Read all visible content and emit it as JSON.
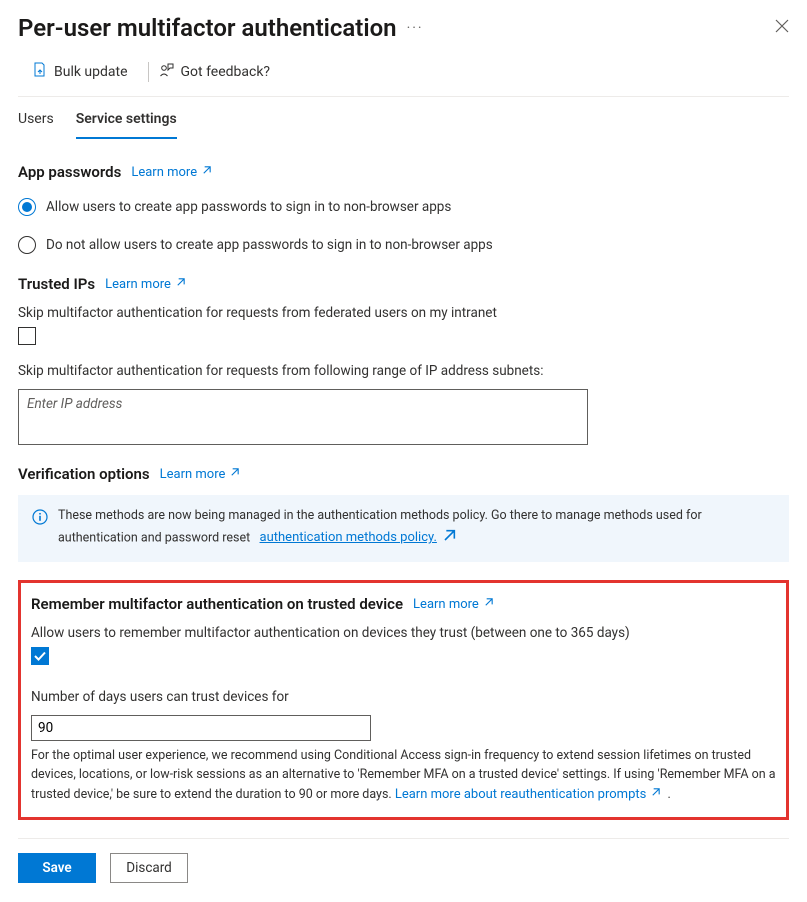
{
  "header": {
    "title": "Per-user multifactor authentication"
  },
  "commandBar": {
    "bulkUpdate": "Bulk update",
    "feedback": "Got feedback?"
  },
  "tabs": {
    "users": "Users",
    "serviceSettings": "Service settings"
  },
  "appPasswords": {
    "title": "App passwords",
    "learnMore": "Learn more",
    "optAllow": "Allow users to create app passwords to sign in to non-browser apps",
    "optDeny": "Do not allow users to create app passwords to sign in to non-browser apps"
  },
  "trustedIps": {
    "title": "Trusted IPs",
    "learnMore": "Learn more",
    "skipFederated": "Skip multifactor authentication for requests from federated users on my intranet",
    "skipRange": "Skip multifactor authentication for requests from following range of IP address subnets:",
    "placeholder": "Enter IP address"
  },
  "verification": {
    "title": "Verification options",
    "learnMore": "Learn more",
    "infoText": "These methods are now being managed in the authentication methods policy. Go there to manage methods used for authentication and password reset",
    "infoLink": "authentication methods policy."
  },
  "remember": {
    "title": "Remember multifactor authentication on trusted device",
    "learnMore": "Learn more",
    "allowLabel": "Allow users to remember multifactor authentication on devices they trust (between one to 365 days)",
    "daysLabel": "Number of days users can trust devices for",
    "daysValue": "90",
    "helperText": "For the optimal user experience, we recommend using Conditional Access sign-in frequency to extend session lifetimes on trusted devices, locations, or low-risk sessions as an alternative to 'Remember MFA on a trusted device' settings. If using 'Remember MFA on a trusted device,' be sure to extend the duration to 90 or more days.",
    "helperLink": "Learn more about reauthentication prompts"
  },
  "footer": {
    "save": "Save",
    "discard": "Discard"
  }
}
